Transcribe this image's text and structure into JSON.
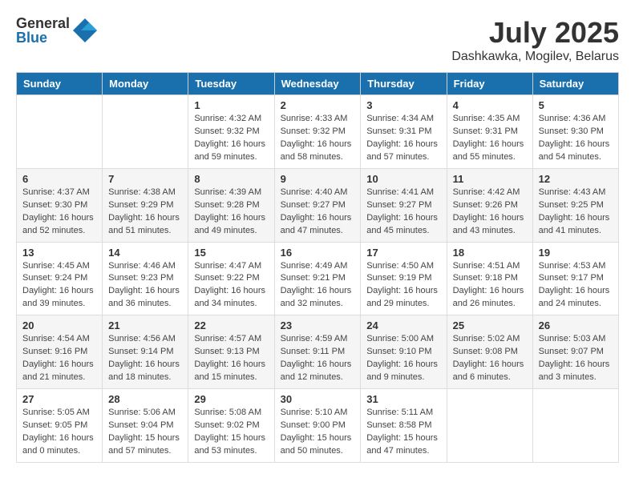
{
  "logo": {
    "general": "General",
    "blue": "Blue"
  },
  "title": "July 2025",
  "location": "Dashkawka, Mogilev, Belarus",
  "headers": [
    "Sunday",
    "Monday",
    "Tuesday",
    "Wednesday",
    "Thursday",
    "Friday",
    "Saturday"
  ],
  "weeks": [
    [
      {
        "day": "",
        "info": ""
      },
      {
        "day": "",
        "info": ""
      },
      {
        "day": "1",
        "info": "Sunrise: 4:32 AM\nSunset: 9:32 PM\nDaylight: 16 hours and 59 minutes."
      },
      {
        "day": "2",
        "info": "Sunrise: 4:33 AM\nSunset: 9:32 PM\nDaylight: 16 hours and 58 minutes."
      },
      {
        "day": "3",
        "info": "Sunrise: 4:34 AM\nSunset: 9:31 PM\nDaylight: 16 hours and 57 minutes."
      },
      {
        "day": "4",
        "info": "Sunrise: 4:35 AM\nSunset: 9:31 PM\nDaylight: 16 hours and 55 minutes."
      },
      {
        "day": "5",
        "info": "Sunrise: 4:36 AM\nSunset: 9:30 PM\nDaylight: 16 hours and 54 minutes."
      }
    ],
    [
      {
        "day": "6",
        "info": "Sunrise: 4:37 AM\nSunset: 9:30 PM\nDaylight: 16 hours and 52 minutes."
      },
      {
        "day": "7",
        "info": "Sunrise: 4:38 AM\nSunset: 9:29 PM\nDaylight: 16 hours and 51 minutes."
      },
      {
        "day": "8",
        "info": "Sunrise: 4:39 AM\nSunset: 9:28 PM\nDaylight: 16 hours and 49 minutes."
      },
      {
        "day": "9",
        "info": "Sunrise: 4:40 AM\nSunset: 9:27 PM\nDaylight: 16 hours and 47 minutes."
      },
      {
        "day": "10",
        "info": "Sunrise: 4:41 AM\nSunset: 9:27 PM\nDaylight: 16 hours and 45 minutes."
      },
      {
        "day": "11",
        "info": "Sunrise: 4:42 AM\nSunset: 9:26 PM\nDaylight: 16 hours and 43 minutes."
      },
      {
        "day": "12",
        "info": "Sunrise: 4:43 AM\nSunset: 9:25 PM\nDaylight: 16 hours and 41 minutes."
      }
    ],
    [
      {
        "day": "13",
        "info": "Sunrise: 4:45 AM\nSunset: 9:24 PM\nDaylight: 16 hours and 39 minutes."
      },
      {
        "day": "14",
        "info": "Sunrise: 4:46 AM\nSunset: 9:23 PM\nDaylight: 16 hours and 36 minutes."
      },
      {
        "day": "15",
        "info": "Sunrise: 4:47 AM\nSunset: 9:22 PM\nDaylight: 16 hours and 34 minutes."
      },
      {
        "day": "16",
        "info": "Sunrise: 4:49 AM\nSunset: 9:21 PM\nDaylight: 16 hours and 32 minutes."
      },
      {
        "day": "17",
        "info": "Sunrise: 4:50 AM\nSunset: 9:19 PM\nDaylight: 16 hours and 29 minutes."
      },
      {
        "day": "18",
        "info": "Sunrise: 4:51 AM\nSunset: 9:18 PM\nDaylight: 16 hours and 26 minutes."
      },
      {
        "day": "19",
        "info": "Sunrise: 4:53 AM\nSunset: 9:17 PM\nDaylight: 16 hours and 24 minutes."
      }
    ],
    [
      {
        "day": "20",
        "info": "Sunrise: 4:54 AM\nSunset: 9:16 PM\nDaylight: 16 hours and 21 minutes."
      },
      {
        "day": "21",
        "info": "Sunrise: 4:56 AM\nSunset: 9:14 PM\nDaylight: 16 hours and 18 minutes."
      },
      {
        "day": "22",
        "info": "Sunrise: 4:57 AM\nSunset: 9:13 PM\nDaylight: 16 hours and 15 minutes."
      },
      {
        "day": "23",
        "info": "Sunrise: 4:59 AM\nSunset: 9:11 PM\nDaylight: 16 hours and 12 minutes."
      },
      {
        "day": "24",
        "info": "Sunrise: 5:00 AM\nSunset: 9:10 PM\nDaylight: 16 hours and 9 minutes."
      },
      {
        "day": "25",
        "info": "Sunrise: 5:02 AM\nSunset: 9:08 PM\nDaylight: 16 hours and 6 minutes."
      },
      {
        "day": "26",
        "info": "Sunrise: 5:03 AM\nSunset: 9:07 PM\nDaylight: 16 hours and 3 minutes."
      }
    ],
    [
      {
        "day": "27",
        "info": "Sunrise: 5:05 AM\nSunset: 9:05 PM\nDaylight: 16 hours and 0 minutes."
      },
      {
        "day": "28",
        "info": "Sunrise: 5:06 AM\nSunset: 9:04 PM\nDaylight: 15 hours and 57 minutes."
      },
      {
        "day": "29",
        "info": "Sunrise: 5:08 AM\nSunset: 9:02 PM\nDaylight: 15 hours and 53 minutes."
      },
      {
        "day": "30",
        "info": "Sunrise: 5:10 AM\nSunset: 9:00 PM\nDaylight: 15 hours and 50 minutes."
      },
      {
        "day": "31",
        "info": "Sunrise: 5:11 AM\nSunset: 8:58 PM\nDaylight: 15 hours and 47 minutes."
      },
      {
        "day": "",
        "info": ""
      },
      {
        "day": "",
        "info": ""
      }
    ]
  ]
}
